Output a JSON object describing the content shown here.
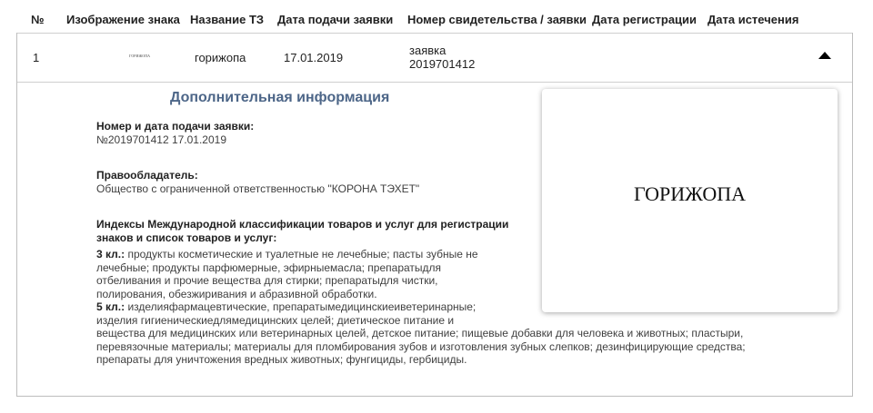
{
  "table": {
    "headers": {
      "num": "№",
      "image": "Изображение знака",
      "name": "Название ТЗ",
      "filing_date": "Дата подачи заявки",
      "cert_number": "Номер свидетельства / заявки",
      "reg_date": "Дата регистрации",
      "exp_date": "Дата истечения"
    },
    "row": {
      "num": "1",
      "image_text": "ГОРИЖОПА",
      "name": "горижопа",
      "filing_date": "17.01.2019",
      "cert_line1": "заявка",
      "cert_line2": "2019701412",
      "reg_date": "",
      "exp_date": "",
      "toggle_icon": "triangle-up-icon"
    }
  },
  "details": {
    "title": "Дополнительная информация",
    "application_label": "Номер и дата подачи заявки:",
    "application_value": "№2019701412 17.01.2019",
    "holder_label": "Правообладатель:",
    "holder_value": "Общество с ограниченной ответственностью \"КОРОНА ТЭХЕТ\"",
    "classes_label_line1": "Индексы Международной классификации товаров и услуг для регистрации",
    "classes_label_line2": "знаков и список товаров и услуг:",
    "class3_label": "3 кл.:",
    "class3_lines": [
      " продукты косметические и туалетные не лечебные; пасты зубные не",
      "лечебные; продукты парфюмерные, эфирныемасла; препаратыдля",
      "отбеливания и прочие вещества для стирки; препаратыдля чистки,",
      "полирования, обезжиривания и абразивной обработки."
    ],
    "class5_label": "5 кл.:",
    "class5_lines": [
      " изделияфармацевтические, препаратымедицинскиеиветеринарные;",
      "изделия гигиеническиедлямедицинских целей; диетическое питание и",
      "вещества для медицинских или ветеринарных целей, детское питание; пищевые добавки для человека и животных; пластыри,",
      "перевязочные материалы; материалы для пломбирования зубов и изготовления зубных слепков; дезинфицирующие средства;",
      "препараты для уничтожения вредных животных; фунгициды, гербициды."
    ]
  },
  "trademark_image": {
    "text": "ГОРИЖОПА"
  }
}
